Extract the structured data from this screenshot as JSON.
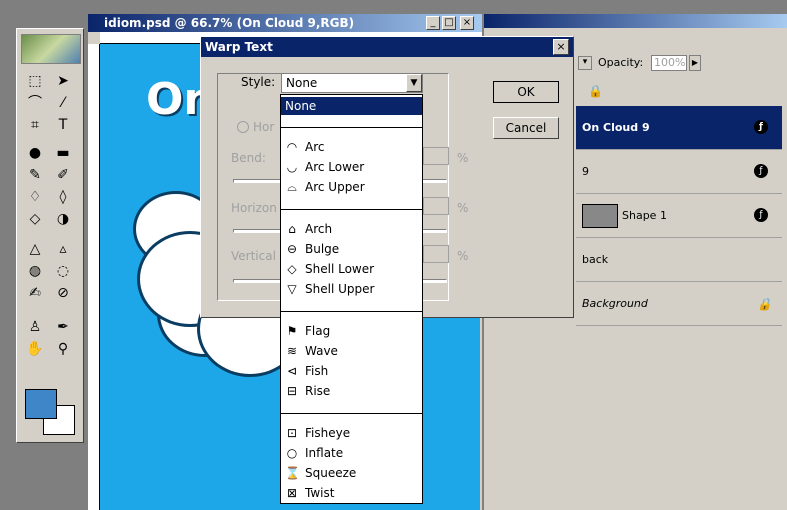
{
  "document": {
    "title": "idiom.psd @ 66.7% (On Cloud 9,RGB)",
    "canvas_text": "On"
  },
  "dialog": {
    "title": "Warp Text",
    "style_label": "Style:",
    "style_value": "None",
    "ok_label": "OK",
    "cancel_label": "Cancel",
    "orientation_label": "Hor",
    "bend_label": "Bend:",
    "horizontal_label": "Horizon",
    "vertical_label": "Vertical",
    "percent": "%"
  },
  "style_options": {
    "none": "None",
    "group1": [
      "Arc",
      "Arc Lower",
      "Arc Upper"
    ],
    "group2": [
      "Arch",
      "Bulge",
      "Shell Lower",
      "Shell Upper"
    ],
    "group3": [
      "Flag",
      "Wave",
      "Fish",
      "Rise"
    ],
    "group4": [
      "Fisheye",
      "Inflate",
      "Squeeze",
      "Twist"
    ]
  },
  "layers": {
    "opacity_label": "Opacity:",
    "opacity_value": "100%",
    "rows": [
      "On Cloud 9",
      "9",
      "Shape 1",
      "back",
      "Background"
    ]
  },
  "colors": {
    "foreground": "#3f86c8",
    "canvas": "#1ea7e8",
    "title_bar": "#0a246a"
  }
}
